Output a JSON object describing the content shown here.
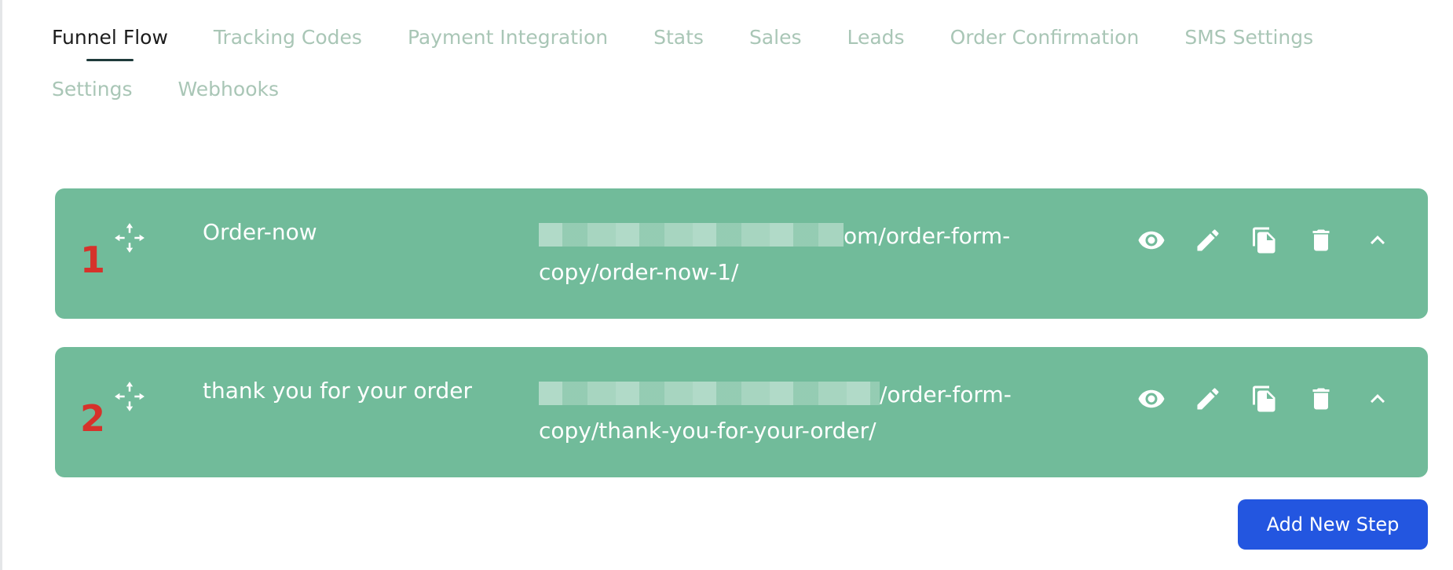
{
  "tabs": [
    {
      "label": "Funnel Flow",
      "active": true
    },
    {
      "label": "Tracking Codes",
      "active": false
    },
    {
      "label": "Payment Integration",
      "active": false
    },
    {
      "label": "Stats",
      "active": false
    },
    {
      "label": "Sales",
      "active": false
    },
    {
      "label": "Leads",
      "active": false
    },
    {
      "label": "Order Confirmation",
      "active": false
    },
    {
      "label": "SMS Settings",
      "active": false
    },
    {
      "label": "Settings",
      "active": false
    },
    {
      "label": "Webhooks",
      "active": false
    }
  ],
  "steps": [
    {
      "number": "1",
      "name": "Order-now",
      "url_line1_suffix": "om/order-form-",
      "url_line2": "copy/order-now-1/"
    },
    {
      "number": "2",
      "name": "thank you for your order",
      "url_line1_suffix": "/order-form-",
      "url_line2": "copy/thank-you-for-your-order/"
    }
  ],
  "actions": [
    "eye-icon",
    "pencil-icon",
    "copy-icon",
    "trash-icon",
    "chevron-up-icon"
  ],
  "add_step_label": "Add New Step",
  "colors": {
    "step_background": "#71bb9a",
    "active_tab_text": "#1c1c1c",
    "inactive_tab_text": "#a9c6b6",
    "step_number": "#d6322b",
    "primary_button": "#2356e0"
  }
}
